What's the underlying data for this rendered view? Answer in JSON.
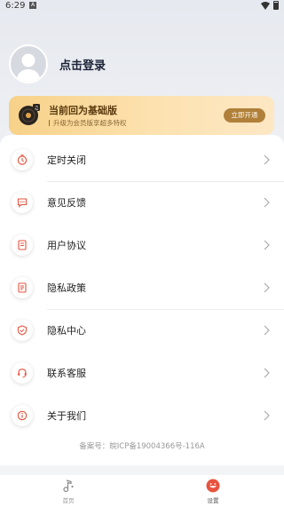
{
  "status_bar": {
    "time": "6:29",
    "notification_icon": "A"
  },
  "profile": {
    "login_text": "点击登录",
    "avatar_icon": "default-avatar-icon"
  },
  "vip": {
    "title": "当前回为基础版",
    "subtitle": "升级为会员版享超多特权",
    "button": "立即开通"
  },
  "menu": {
    "items": [
      {
        "label": "定时关闭",
        "icon": "timer-icon"
      },
      {
        "label": "意见反馈",
        "icon": "feedback-icon"
      },
      {
        "label": "用户协议",
        "icon": "user-agreement-icon"
      },
      {
        "label": "隐私政策",
        "icon": "privacy-policy-icon"
      },
      {
        "label": "隐私中心",
        "icon": "privacy-center-icon"
      },
      {
        "label": "联系客服",
        "icon": "customer-service-icon"
      },
      {
        "label": "关于我们",
        "icon": "about-icon"
      }
    ]
  },
  "icp": "备案号：皖ICP备19004366号-116A",
  "tabs": [
    {
      "label": "首页",
      "icon": "music-note-icon",
      "active": false
    },
    {
      "label": "设置",
      "icon": "settings-face-icon",
      "active": true
    }
  ],
  "colors": {
    "accent": "#e8533f",
    "vip_button": "#b0803a"
  }
}
